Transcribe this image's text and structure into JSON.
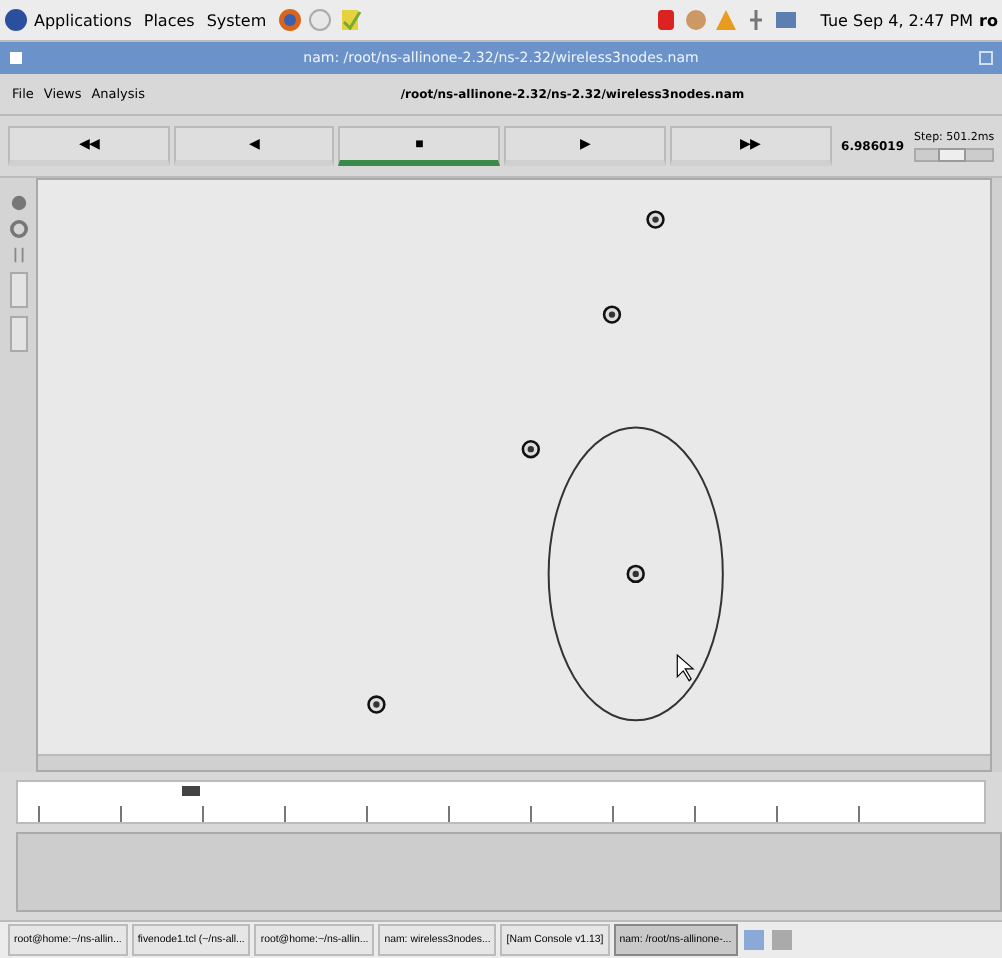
{
  "top_panel": {
    "menus": [
      "Applications",
      "Places",
      "System"
    ],
    "clock": "Tue Sep 4, 2:47 PM",
    "user": "ro"
  },
  "window": {
    "title": "nam: /root/ns-allinone-2.32/ns-2.32/wireless3nodes.nam"
  },
  "menu_bar": [
    "File",
    "Views",
    "Analysis"
  ],
  "file_path": "/root/ns-allinone-2.32/ns-2.32/wireless3nodes.nam",
  "controls": [
    {
      "label": "◀◀",
      "selected": false
    },
    {
      "label": "◀",
      "selected": false
    },
    {
      "label": "■",
      "selected": true
    },
    {
      "label": "▶",
      "selected": false
    },
    {
      "label": "▶▶",
      "selected": false
    }
  ],
  "time_display": "6.986019",
  "step": {
    "label": "Step: 501.2ms",
    "level": 0.45
  },
  "timeline": {
    "level": 0.17
  },
  "taskbar": [
    {
      "label": "root@home:~/ns-allin...",
      "selected": false
    },
    {
      "label": "fivenode1.tcl (~/ns-all...",
      "selected": false
    },
    {
      "label": "root@home:~/ns-allin...",
      "selected": false
    },
    {
      "label": "nam: wireless3nodes...",
      "selected": false
    },
    {
      "label": "[Nam Console v1.13]",
      "selected": false
    },
    {
      "label": "nam: /root/ns-allinone-...",
      "selected": true
    }
  ]
}
